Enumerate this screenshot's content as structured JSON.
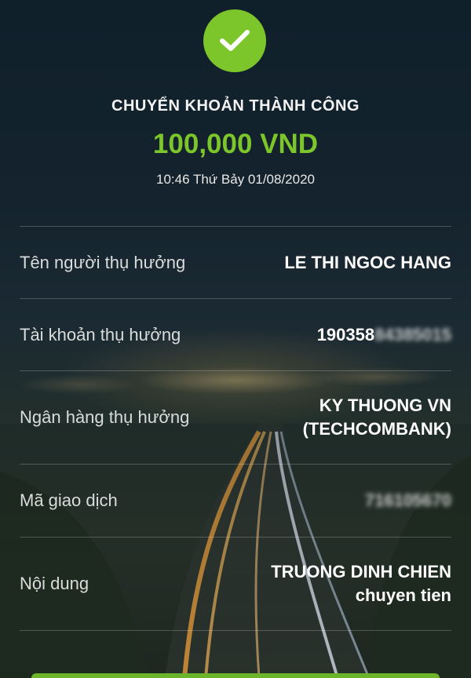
{
  "receipt": {
    "title": "CHUYỂN KHOẢN THÀNH CÔNG",
    "amount": "100,000 VND",
    "datetime": "10:46 Thứ Bảy 01/08/2020"
  },
  "details": {
    "beneficiary_name_label": "Tên người thụ hưởng",
    "beneficiary_name_value": "LE THI NGOC HANG",
    "account_label": "Tài khoản thụ hưởng",
    "account_visible": "190358",
    "account_blurred": "84385015",
    "bank_label": "Ngân hàng thụ hưởng",
    "bank_line1": "KY THUONG VN",
    "bank_line2": "(TECHCOMBANK)",
    "transaction_label": "Mã giao dịch",
    "transaction_blurred": "716105670",
    "content_label": "Nội dung",
    "content_line1": "TRUONG DINH CHIEN",
    "content_line2": "chuyen tien"
  },
  "colors": {
    "accent_green": "#7cc52a",
    "background": "#14232d"
  },
  "icons": {
    "success": "check-icon"
  }
}
